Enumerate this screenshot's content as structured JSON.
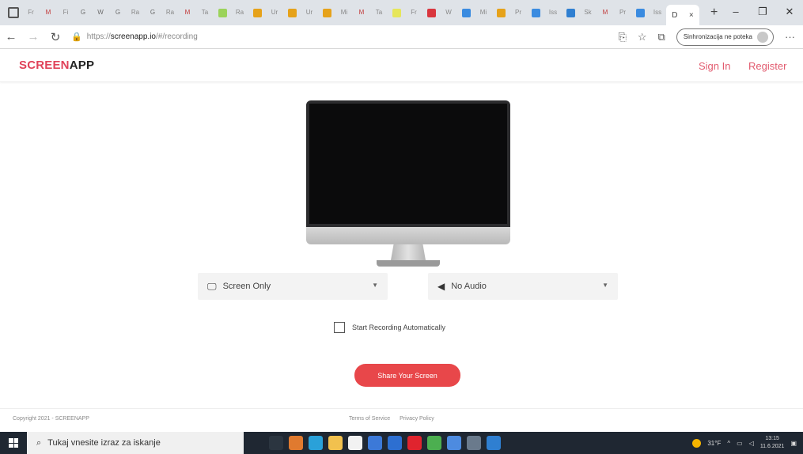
{
  "browser": {
    "active_tab_letter": "D",
    "new_tab_symbol": "+",
    "tab_close_symbol": "×",
    "tabs": [
      {
        "text": "Fr",
        "color": "#888888"
      },
      {
        "text": "M",
        "color": "#c23a3a"
      },
      {
        "text": "Fi",
        "color": "#888888"
      },
      {
        "text": "G",
        "color": "#6b6b6b"
      },
      {
        "text": "W",
        "color": "#6b6b6b"
      },
      {
        "text": "G",
        "color": "#6b6b6b"
      },
      {
        "text": "Ra",
        "color": "#888888"
      },
      {
        "text": "G",
        "color": "#6b6b6b"
      },
      {
        "text": "Ra",
        "color": "#888888"
      },
      {
        "text": "M",
        "color": "#c23a3a"
      },
      {
        "text": "Ta",
        "color": "#888888"
      },
      {
        "text": "",
        "color": "#9bd35a"
      },
      {
        "text": "Ra",
        "color": "#888888"
      },
      {
        "text": "",
        "color": "#e6a21a"
      },
      {
        "text": "Ur",
        "color": "#888888"
      },
      {
        "text": "",
        "color": "#e6a21a"
      },
      {
        "text": "Ur",
        "color": "#888888"
      },
      {
        "text": "",
        "color": "#e6a21a"
      },
      {
        "text": "Mi",
        "color": "#888888"
      },
      {
        "text": "M",
        "color": "#c23a3a"
      },
      {
        "text": "Ta",
        "color": "#888888"
      },
      {
        "text": "",
        "color": "#e6e65a"
      },
      {
        "text": "Fr",
        "color": "#888888"
      },
      {
        "text": "",
        "color": "#d9363e"
      },
      {
        "text": "W",
        "color": "#888888"
      },
      {
        "text": "",
        "color": "#3a8be0"
      },
      {
        "text": "Mi",
        "color": "#888888"
      },
      {
        "text": "",
        "color": "#e6a21a"
      },
      {
        "text": "Pr",
        "color": "#888888"
      },
      {
        "text": "",
        "color": "#3a8be0"
      },
      {
        "text": "Iss",
        "color": "#888888"
      },
      {
        "text": "",
        "color": "#2f7fd1"
      },
      {
        "text": "Sk",
        "color": "#888888"
      },
      {
        "text": "M",
        "color": "#c23a3a"
      },
      {
        "text": "Pr",
        "color": "#888888"
      },
      {
        "text": "",
        "color": "#3a8be0"
      },
      {
        "text": "Iss",
        "color": "#888888"
      }
    ],
    "window_controls": [
      "–",
      "❐",
      "✕"
    ],
    "url_prefix": "https://",
    "url_domain": "screenapp.io",
    "url_path": "/#/recording",
    "sync_label": "Sinhronizacija ne poteka",
    "menu_glyph": "···"
  },
  "site": {
    "logo_part1": "SCREEN",
    "logo_part2": "APP",
    "sign_in": "Sign In",
    "register": "Register"
  },
  "recorder": {
    "screen_select": {
      "value": "Screen Only"
    },
    "audio_select": {
      "value": "No Audio"
    },
    "auto_start_label": "Start Recording Automatically",
    "share_button": "Share Your Screen"
  },
  "footer": {
    "copyright": "Copyright 2021 - SCREENAPP",
    "terms": "Terms of Service",
    "privacy": "Privacy Policy"
  },
  "taskbar": {
    "search_placeholder": "Tukaj vnesite izraz za iskanje",
    "weather": "31°F",
    "time": "13:15",
    "date": "11.6.2021",
    "apps": [
      {
        "name": "task-view",
        "color": "#2b3540"
      },
      {
        "name": "paint",
        "color": "#e07a2f"
      },
      {
        "name": "edge",
        "color": "#2aa1d9"
      },
      {
        "name": "file-explorer",
        "color": "#f2c14e"
      },
      {
        "name": "store",
        "color": "#f2f2f2"
      },
      {
        "name": "app-blue",
        "color": "#3c79d8"
      },
      {
        "name": "mail",
        "color": "#2d6fd1"
      },
      {
        "name": "opera",
        "color": "#e0242e"
      },
      {
        "name": "chrome",
        "color": "#4caf50"
      },
      {
        "name": "app-blue-2",
        "color": "#4d8be0"
      },
      {
        "name": "app-gray",
        "color": "#6a7a8c"
      },
      {
        "name": "app-blue-3",
        "color": "#2f7fd1"
      }
    ]
  }
}
